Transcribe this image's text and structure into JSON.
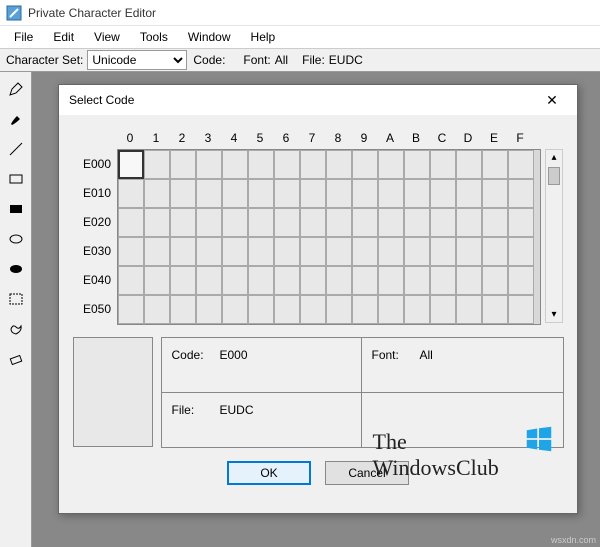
{
  "app": {
    "title": "Private Character Editor"
  },
  "menu": {
    "items": [
      "File",
      "Edit",
      "View",
      "Tools",
      "Window",
      "Help"
    ]
  },
  "charsetRow": {
    "label": "Character Set:",
    "value": "Unicode",
    "codeLabel": "Code:",
    "fontLabel": "Font:",
    "fontValue": "All",
    "fileLabel": "File:",
    "fileValue": "EUDC"
  },
  "tools": [
    "pencil",
    "brush",
    "line",
    "rect",
    "rect-filled",
    "ellipse",
    "ellipse-filled",
    "select",
    "freeform",
    "eraser"
  ],
  "dialog": {
    "title": "Select Code",
    "cols": [
      "0",
      "1",
      "2",
      "3",
      "4",
      "5",
      "6",
      "7",
      "8",
      "9",
      "A",
      "B",
      "C",
      "D",
      "E",
      "F"
    ],
    "rows": [
      "E000",
      "E010",
      "E020",
      "E030",
      "E040",
      "E050"
    ],
    "selected": {
      "r": 0,
      "c": 0
    },
    "info": {
      "codeLabel": "Code:",
      "codeValue": "E000",
      "fontLabel": "Font:",
      "fontValue": "All",
      "fileLabel": "File:",
      "fileValue": "EUDC"
    },
    "ok": "OK",
    "cancel": "Cancel"
  },
  "watermark": {
    "line1": "The",
    "line2": "WindowsClub"
  },
  "credit": "wsxdn.com"
}
